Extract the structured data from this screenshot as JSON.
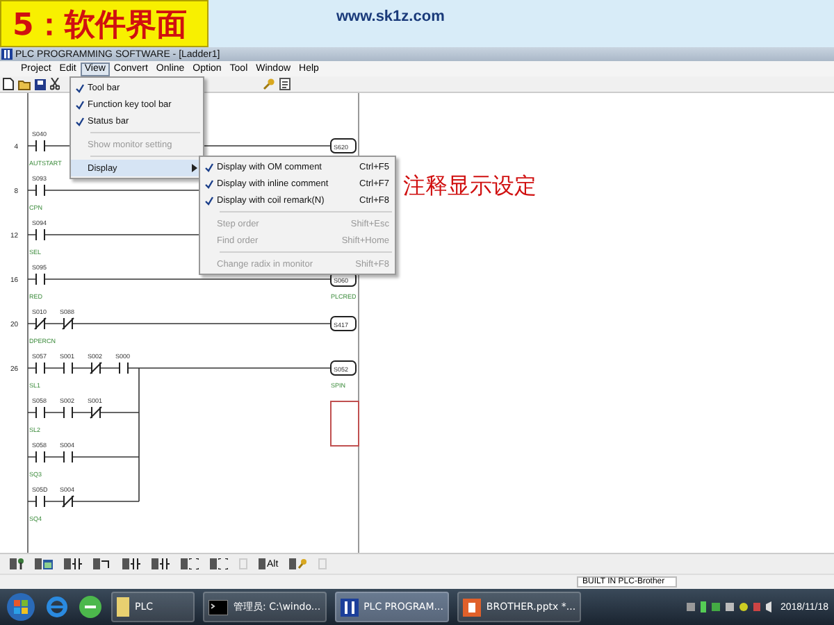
{
  "slide": {
    "title": "5：软件界面",
    "site": "www.sk1z.com",
    "annotation": "注释显示设定"
  },
  "window": {
    "title": "PLC PROGRAMMING SOFTWARE - [Ladder1]"
  },
  "menu_bar": [
    {
      "label": "Project",
      "selected": false
    },
    {
      "label": "Edit",
      "selected": false
    },
    {
      "label": "View",
      "selected": true
    },
    {
      "label": "Convert",
      "selected": false
    },
    {
      "label": "Online",
      "selected": false
    },
    {
      "label": "Option",
      "selected": false
    },
    {
      "label": "Tool",
      "selected": false
    },
    {
      "label": "Window",
      "selected": false
    },
    {
      "label": "Help",
      "selected": false
    }
  ],
  "toolbar": [
    {
      "kind": "new"
    },
    {
      "kind": "open"
    },
    {
      "kind": "save"
    },
    {
      "kind": "cut"
    },
    {
      "kind": "key"
    },
    {
      "kind": "document"
    }
  ],
  "view_menu": [
    {
      "label": "Tool bar",
      "checked": true,
      "disabled": false,
      "selected": false
    },
    {
      "label": "Function key tool bar",
      "checked": true,
      "disabled": false,
      "selected": false
    },
    {
      "label": "Status bar",
      "checked": true,
      "disabled": false,
      "selected": false
    },
    {
      "label": "Show monitor setting",
      "checked": false,
      "disabled": true,
      "selected": false
    },
    {
      "label": "Display",
      "checked": false,
      "disabled": false,
      "selected": true,
      "submenu": true
    }
  ],
  "display_submenu": [
    {
      "label": "Display with OM comment",
      "shortcut": "Ctrl+F5",
      "checked": true,
      "disabled": false
    },
    {
      "label": "Display with inline comment",
      "shortcut": "Ctrl+F7",
      "checked": true,
      "disabled": false
    },
    {
      "label": "Display with coil remark(N)",
      "shortcut": "Ctrl+F8",
      "checked": true,
      "disabled": false
    },
    {
      "label": "Step order",
      "shortcut": "Shift+Esc",
      "checked": false,
      "disabled": true
    },
    {
      "label": "Find order",
      "shortcut": "Shift+Home",
      "checked": false,
      "disabled": true
    },
    {
      "label": "Change radix in monitor",
      "shortcut": "Shift+F8",
      "checked": false,
      "disabled": true
    }
  ],
  "ladder": [
    {
      "step": "4",
      "contacts": [
        {
          "label": "S040",
          "kind": "no"
        }
      ],
      "comment": "AUTSTART",
      "coil": "S620"
    },
    {
      "step": "8",
      "contacts": [
        {
          "label": "S093",
          "kind": "no"
        }
      ],
      "comment": "CPN"
    },
    {
      "step": "12",
      "contacts": [
        {
          "label": "S094",
          "kind": "no"
        }
      ],
      "comment": "SEL"
    },
    {
      "step": "16",
      "contacts": [
        {
          "label": "S095",
          "kind": "no"
        }
      ],
      "comment": "RED",
      "coil": "S060",
      "coil_comment": "PLCRED"
    },
    {
      "step": "20",
      "contacts": [
        {
          "label": "S010",
          "kind": "nc"
        },
        {
          "label": "S088",
          "kind": "nc"
        }
      ],
      "comment": "DPERCN",
      "coil": "S417"
    },
    {
      "step": "26",
      "contacts": [
        {
          "label": "S057",
          "kind": "no"
        },
        {
          "label": "S001",
          "kind": "no"
        },
        {
          "label": "S002",
          "kind": "nc"
        },
        {
          "label": "S000",
          "kind": "no"
        }
      ],
      "comment": "SL1",
      "coil": "S052",
      "coil_comment": "SPIN"
    },
    {
      "contacts": [
        {
          "label": "S058",
          "kind": "no"
        },
        {
          "label": "S002",
          "kind": "no"
        },
        {
          "label": "S001",
          "kind": "nc"
        }
      ],
      "comment": "SL2"
    },
    {
      "contacts": [
        {
          "label": "S058",
          "kind": "no"
        },
        {
          "label": "S004",
          "kind": "no"
        }
      ],
      "comment": "SQ3"
    },
    {
      "contacts": [
        {
          "label": "S05D",
          "kind": "no"
        },
        {
          "label": "S004",
          "kind": "nc"
        }
      ],
      "comment": "SQ4"
    }
  ],
  "function_keys": [
    {
      "kind": "help"
    },
    {
      "kind": "window"
    },
    {
      "kind": "contact"
    },
    {
      "kind": "wire"
    },
    {
      "kind": "contact"
    },
    {
      "kind": "contact"
    },
    {
      "kind": "coil"
    },
    {
      "kind": "coil"
    },
    {
      "kind": "blank"
    },
    {
      "kind": "alt",
      "label": "Alt"
    },
    {
      "kind": "key"
    },
    {
      "kind": "blank"
    }
  ],
  "status_bar": {
    "plc": "BUILT IN PLC-Brother"
  },
  "taskbar": {
    "buttons": [
      {
        "kind": "folder",
        "label": "PLC"
      },
      {
        "kind": "console",
        "label": "管理员: C:\\windo..."
      },
      {
        "kind": "plc",
        "label": "PLC PROGRAM..."
      },
      {
        "kind": "slides",
        "label": "BROTHER.pptx *..."
      }
    ],
    "date": "2018/11/18"
  }
}
